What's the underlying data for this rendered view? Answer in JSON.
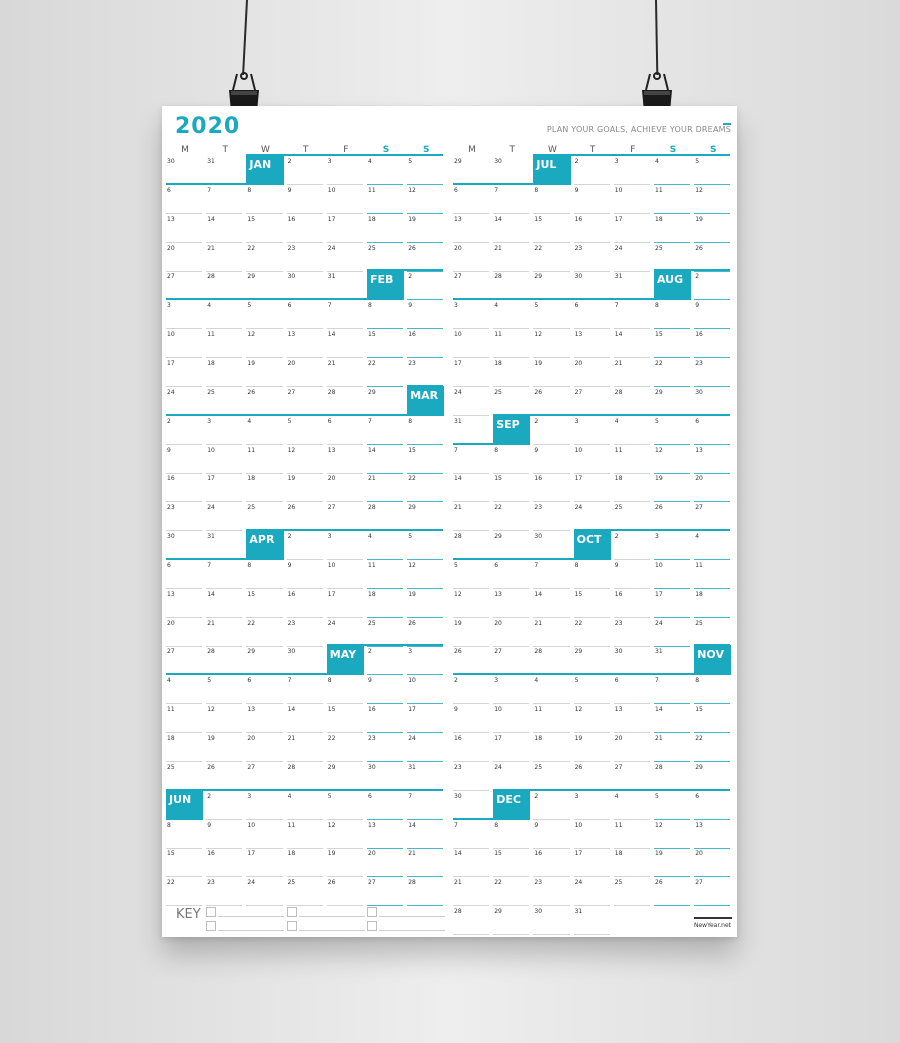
{
  "calendar": {
    "year": "2020",
    "tagline": "PLAN YOUR GOALS, ACHIEVE YOUR DREAMS",
    "day_headers": [
      "M",
      "T",
      "W",
      "T",
      "F",
      "S",
      "S"
    ],
    "key_label": "KEY",
    "brand": "NewYear.net",
    "accent_color": "#1ba9c0",
    "months": [
      "JAN",
      "FEB",
      "MAR",
      "APR",
      "MAY",
      "JUN",
      "JUL",
      "AUG",
      "SEP",
      "OCT",
      "NOV",
      "DEC"
    ],
    "left_rows": [
      [
        "30",
        "31",
        "",
        "2",
        "3",
        "4",
        "5"
      ],
      [
        "6",
        "7",
        "8",
        "9",
        "10",
        "11",
        "12"
      ],
      [
        "13",
        "14",
        "15",
        "16",
        "17",
        "18",
        "19"
      ],
      [
        "20",
        "21",
        "22",
        "23",
        "24",
        "25",
        "26"
      ],
      [
        "27",
        "28",
        "29",
        "30",
        "31",
        "",
        "2"
      ],
      [
        "3",
        "4",
        "5",
        "6",
        "7",
        "8",
        "9"
      ],
      [
        "10",
        "11",
        "12",
        "13",
        "14",
        "15",
        "16"
      ],
      [
        "17",
        "18",
        "19",
        "20",
        "21",
        "22",
        "23"
      ],
      [
        "24",
        "25",
        "26",
        "27",
        "28",
        "29",
        ""
      ],
      [
        "2",
        "3",
        "4",
        "5",
        "6",
        "7",
        "8"
      ],
      [
        "9",
        "10",
        "11",
        "12",
        "13",
        "14",
        "15"
      ],
      [
        "16",
        "17",
        "18",
        "19",
        "20",
        "21",
        "22"
      ],
      [
        "23",
        "24",
        "25",
        "26",
        "27",
        "28",
        "29"
      ],
      [
        "30",
        "31",
        "",
        "2",
        "3",
        "4",
        "5"
      ],
      [
        "6",
        "7",
        "8",
        "9",
        "10",
        "11",
        "12"
      ],
      [
        "13",
        "14",
        "15",
        "16",
        "17",
        "18",
        "19"
      ],
      [
        "20",
        "21",
        "22",
        "23",
        "24",
        "25",
        "26"
      ],
      [
        "27",
        "28",
        "29",
        "30",
        "",
        "2",
        "3"
      ],
      [
        "4",
        "5",
        "6",
        "7",
        "8",
        "9",
        "10"
      ],
      [
        "11",
        "12",
        "13",
        "14",
        "15",
        "16",
        "17"
      ],
      [
        "18",
        "19",
        "20",
        "21",
        "22",
        "23",
        "24"
      ],
      [
        "25",
        "26",
        "27",
        "28",
        "29",
        "30",
        "31"
      ],
      [
        "",
        "2",
        "3",
        "4",
        "5",
        "6",
        "7"
      ],
      [
        "8",
        "9",
        "10",
        "11",
        "12",
        "13",
        "14"
      ],
      [
        "15",
        "16",
        "17",
        "18",
        "19",
        "20",
        "21"
      ],
      [
        "22",
        "23",
        "24",
        "25",
        "26",
        "27",
        "28"
      ]
    ],
    "right_rows": [
      [
        "29",
        "30",
        "",
        "2",
        "3",
        "4",
        "5"
      ],
      [
        "6",
        "7",
        "8",
        "9",
        "10",
        "11",
        "12"
      ],
      [
        "13",
        "14",
        "15",
        "16",
        "17",
        "18",
        "19"
      ],
      [
        "20",
        "21",
        "22",
        "23",
        "24",
        "25",
        "26"
      ],
      [
        "27",
        "28",
        "29",
        "30",
        "31",
        "",
        "2"
      ],
      [
        "3",
        "4",
        "5",
        "6",
        "7",
        "8",
        "9"
      ],
      [
        "10",
        "11",
        "12",
        "13",
        "14",
        "15",
        "16"
      ],
      [
        "17",
        "18",
        "19",
        "20",
        "21",
        "22",
        "23"
      ],
      [
        "24",
        "25",
        "26",
        "27",
        "28",
        "29",
        "30"
      ],
      [
        "31",
        "",
        "2",
        "3",
        "4",
        "5",
        "6"
      ],
      [
        "7",
        "8",
        "9",
        "10",
        "11",
        "12",
        "13"
      ],
      [
        "14",
        "15",
        "16",
        "17",
        "18",
        "19",
        "20"
      ],
      [
        "21",
        "22",
        "23",
        "24",
        "25",
        "26",
        "27"
      ],
      [
        "28",
        "29",
        "30",
        "",
        "2",
        "3",
        "4"
      ],
      [
        "5",
        "6",
        "7",
        "8",
        "9",
        "10",
        "11"
      ],
      [
        "12",
        "13",
        "14",
        "15",
        "16",
        "17",
        "18"
      ],
      [
        "19",
        "20",
        "21",
        "22",
        "23",
        "24",
        "25"
      ],
      [
        "26",
        "27",
        "28",
        "29",
        "30",
        "31",
        ""
      ],
      [
        "2",
        "3",
        "4",
        "5",
        "6",
        "7",
        "8"
      ],
      [
        "9",
        "10",
        "11",
        "12",
        "13",
        "14",
        "15"
      ],
      [
        "16",
        "17",
        "18",
        "19",
        "20",
        "21",
        "22"
      ],
      [
        "23",
        "24",
        "25",
        "26",
        "27",
        "28",
        "29"
      ],
      [
        "30",
        "",
        "2",
        "3",
        "4",
        "5",
        "6"
      ],
      [
        "7",
        "8",
        "9",
        "10",
        "11",
        "12",
        "13"
      ],
      [
        "14",
        "15",
        "16",
        "17",
        "18",
        "19",
        "20"
      ],
      [
        "21",
        "22",
        "23",
        "24",
        "25",
        "26",
        "27"
      ],
      [
        "28",
        "29",
        "30",
        "31",
        "",
        "",
        ""
      ]
    ]
  }
}
